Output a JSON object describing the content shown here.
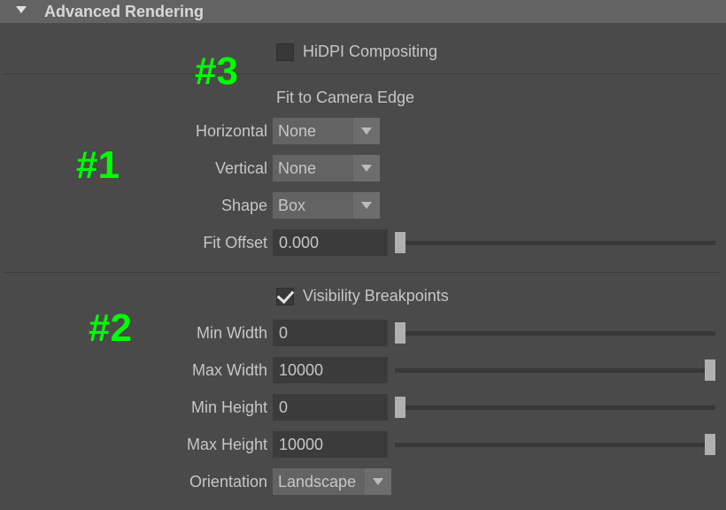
{
  "header": {
    "title": "Advanced Rendering"
  },
  "hidpi": {
    "label": "HiDPI Compositing",
    "checked": false
  },
  "fitSection": {
    "title": "Fit to Camera Edge",
    "horizontal": {
      "label": "Horizontal",
      "value": "None"
    },
    "vertical": {
      "label": "Vertical",
      "value": "None"
    },
    "shape": {
      "label": "Shape",
      "value": "Box"
    },
    "fitOffset": {
      "label": "Fit Offset",
      "value": "0.000",
      "min": 0,
      "max": 1,
      "pos": 0
    }
  },
  "vis": {
    "label": "Visibility Breakpoints",
    "checked": true,
    "minWidth": {
      "label": "Min Width",
      "value": "0",
      "pos": 0
    },
    "maxWidth": {
      "label": "Max Width",
      "value": "10000",
      "pos": 1
    },
    "minHeight": {
      "label": "Min Height",
      "value": "0",
      "pos": 0
    },
    "maxHeight": {
      "label": "Max Height",
      "value": "10000",
      "pos": 1
    },
    "orientation": {
      "label": "Orientation",
      "value": "Landscape"
    }
  },
  "annotations": {
    "a1": "#1",
    "a2": "#2",
    "a3": "#3"
  }
}
